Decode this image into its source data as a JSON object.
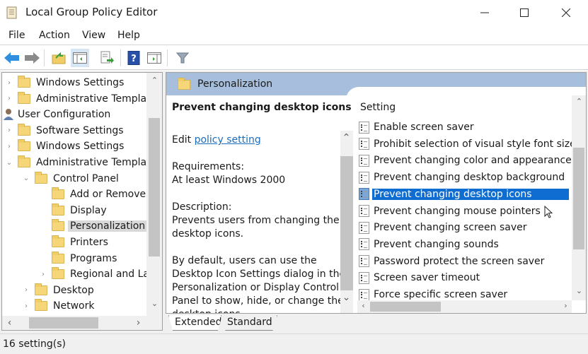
{
  "window": {
    "title": "Local Group Policy Editor",
    "minimize_icon": "minimize-icon",
    "maximize_icon": "maximize-icon",
    "close_icon": "close-icon"
  },
  "menu": [
    {
      "label": "File"
    },
    {
      "label": "Action"
    },
    {
      "label": "View"
    },
    {
      "label": "Help"
    }
  ],
  "toolbar": [
    {
      "name": "back",
      "icon": "back-arrow-icon"
    },
    {
      "name": "forward",
      "icon": "forward-arrow-icon"
    },
    {
      "name": "up-one-level",
      "icon": "folder-up-icon"
    },
    {
      "name": "show-hide-console-tree",
      "icon": "console-tree-icon"
    },
    {
      "name": "export-list",
      "icon": "export-list-icon"
    },
    {
      "name": "help",
      "icon": "help-icon"
    },
    {
      "name": "show-hide-action-pane",
      "icon": "action-pane-icon"
    },
    {
      "name": "filter",
      "icon": "filter-icon"
    }
  ],
  "tree": {
    "items": [
      {
        "label": "Windows Settings",
        "expander": "collapsed",
        "type": "folder"
      },
      {
        "label": "Administrative Template",
        "expander": "collapsed",
        "type": "folder"
      },
      {
        "label": "User Configuration",
        "expander": "none",
        "type": "user"
      },
      {
        "label": "Software Settings",
        "expander": "collapsed",
        "type": "folder"
      },
      {
        "label": "Windows Settings",
        "expander": "collapsed",
        "type": "folder"
      },
      {
        "label": "Administrative Template",
        "expander": "expanded",
        "type": "folder"
      },
      {
        "label": "Control Panel",
        "expander": "expanded",
        "type": "folder"
      },
      {
        "label": "Add or Remove P",
        "expander": "none",
        "type": "folder"
      },
      {
        "label": "Display",
        "expander": "none",
        "type": "folder"
      },
      {
        "label": "Personalization",
        "expander": "none",
        "type": "folder",
        "selected": true
      },
      {
        "label": "Printers",
        "expander": "none",
        "type": "folder"
      },
      {
        "label": "Programs",
        "expander": "none",
        "type": "folder"
      },
      {
        "label": "Regional and Lar",
        "expander": "collapsed",
        "type": "folder"
      },
      {
        "label": "Desktop",
        "expander": "collapsed",
        "type": "folder"
      },
      {
        "label": "Network",
        "expander": "collapsed",
        "type": "folder"
      }
    ]
  },
  "details": {
    "header": "Personalization",
    "title": "Prevent changing desktop icons",
    "edit_prefix": "Edit",
    "edit_link": "policy setting",
    "requirements_label": "Requirements:",
    "requirements_value": "At least Windows 2000",
    "description_label": "Description:",
    "description": "Prevents users from changing the desktop icons.",
    "description_more": "By default, users can use the Desktop Icon Settings dialog in the Personalization or Display Control Panel to show, hide, or change the desktop icons."
  },
  "settings": {
    "column_header": "Setting",
    "rows": [
      {
        "label": "Enable screen saver"
      },
      {
        "label": "Prohibit selection of visual style font size"
      },
      {
        "label": "Prevent changing color and appearance"
      },
      {
        "label": "Prevent changing desktop background"
      },
      {
        "label": "Prevent changing desktop icons",
        "selected": true
      },
      {
        "label": "Prevent changing mouse pointers"
      },
      {
        "label": "Prevent changing screen saver"
      },
      {
        "label": "Prevent changing sounds"
      },
      {
        "label": "Password protect the screen saver"
      },
      {
        "label": "Screen saver timeout"
      },
      {
        "label": "Force specific screen saver"
      }
    ]
  },
  "tabs": [
    {
      "label": "Extended",
      "active": true
    },
    {
      "label": "Standard",
      "active": false
    }
  ],
  "status": {
    "text": "16 setting(s)"
  },
  "colors": {
    "selection": "#0f6cd1",
    "header_band": "#a7bfdc",
    "link": "#1b6cbd"
  }
}
